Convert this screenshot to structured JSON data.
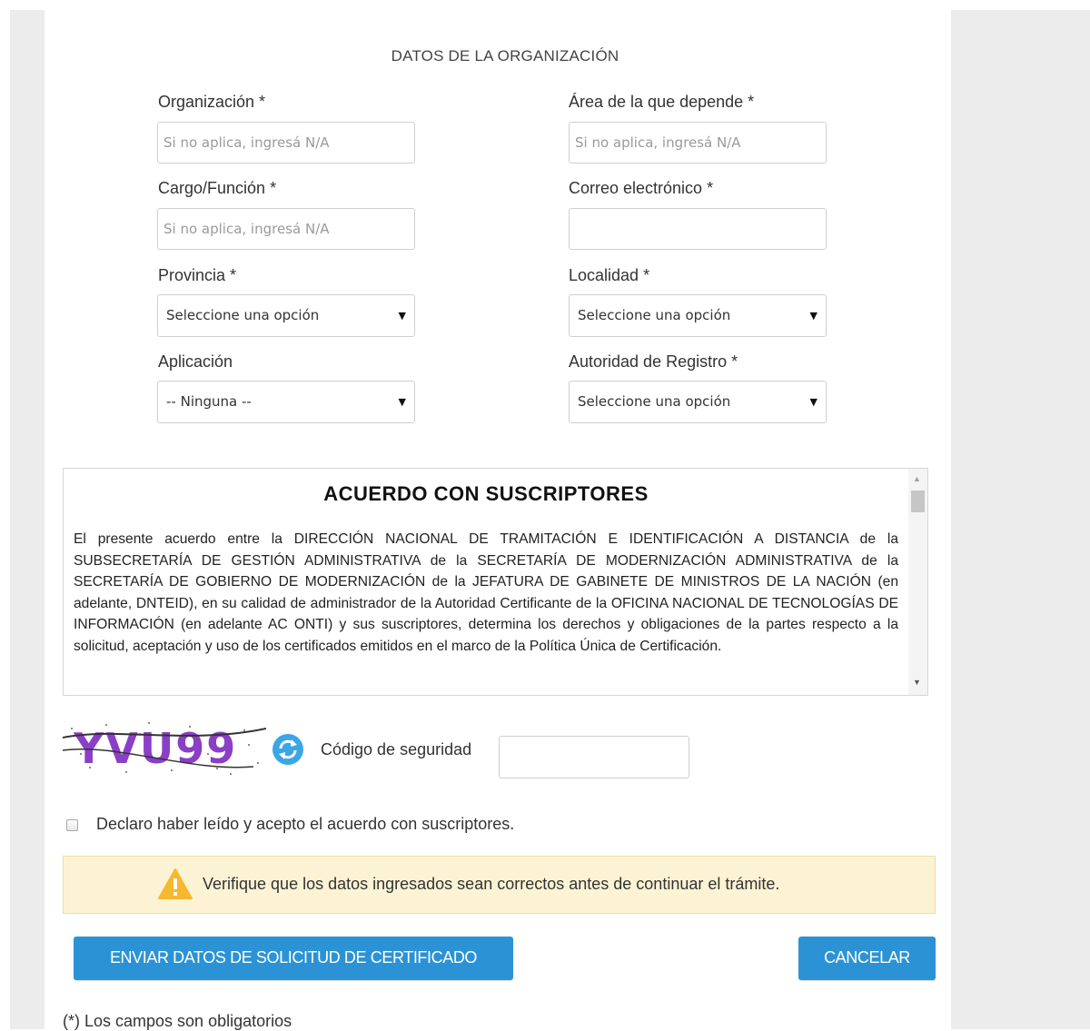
{
  "section_title": "DATOS DE LA ORGANIZACIÓN",
  "fields": {
    "organizacion": {
      "label": "Organización *",
      "placeholder": "Si no aplica, ingresá N/A"
    },
    "area": {
      "label": "Área de la que depende *",
      "placeholder": "Si no aplica, ingresá N/A"
    },
    "cargo": {
      "label": "Cargo/Función *",
      "placeholder": "Si no aplica, ingresá N/A"
    },
    "correo": {
      "label": "Correo electrónico *",
      "placeholder": ""
    },
    "provincia": {
      "label": "Provincia *",
      "value": "Seleccione una opción"
    },
    "localidad": {
      "label": "Localidad *",
      "value": "Seleccione una opción"
    },
    "aplicacion": {
      "label": "Aplicación",
      "value": "-- Ninguna --"
    },
    "autoridad": {
      "label": "Autoridad de Registro *",
      "value": "Seleccione una opción"
    }
  },
  "select_arrow": "▼",
  "agreement": {
    "title": "ACUERDO CON SUSCRIPTORES",
    "text": "El presente acuerdo entre la DIRECCIÓN NACIONAL DE TRAMITACIÓN E IDENTIFICACIÓN A DISTANCIA de la SUBSECRETARÍA DE GESTIÓN ADMINISTRATIVA de la SECRETARÍA DE MODERNIZACIÓN ADMINISTRATIVA de la SECRETARÍA DE GOBIERNO DE MODERNIZACIÓN de la JEFATURA DE GABINETE DE MINISTROS DE LA NACIÓN (en adelante, DNTEID), en su calidad de administrador de la Autoridad Certificante de la OFICINA NACIONAL DE TECNOLOGÍAS DE INFORMACIÓN (en adelante AC ONTI) y sus suscriptores, determina los derechos y obligaciones de la partes respecto a la solicitud, aceptación y uso de los certificados emitidos en el marco de la Política Única de Certificación."
  },
  "captcha": {
    "image_text": "YVU99",
    "label": "Código de seguridad",
    "value": ""
  },
  "checkbox": {
    "label": "Declaro haber leído y acepto el acuerdo con suscriptores.",
    "checked": false
  },
  "warning": {
    "text": "Verifique que los datos ingresados sean correctos antes de continuar el trámite."
  },
  "buttons": {
    "submit": "ENVIAR DATOS DE SOLICITUD DE CERTIFICADO",
    "cancel": "CANCELAR"
  },
  "footnote": "(*) Los campos son obligatorios",
  "colors": {
    "primary_button": "#2b93d5",
    "warning_bg": "#fcf3d4",
    "warning_icon": "#f5b82e",
    "captcha_text": "#8a3fc7",
    "refresh_icon": "#3aa6e6"
  }
}
